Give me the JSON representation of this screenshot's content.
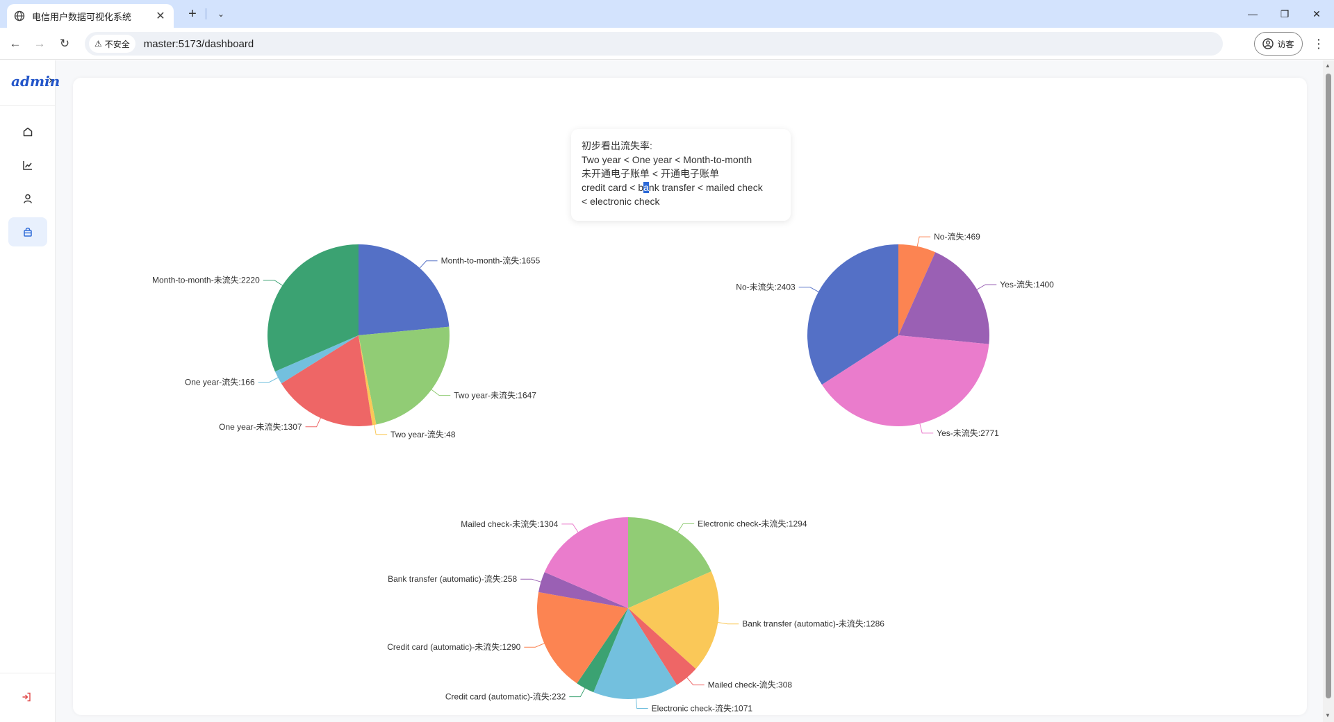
{
  "browser": {
    "tab_title": "电信用户数据可视化系统",
    "security_label": "不安全",
    "url": "master:5173/dashboard",
    "profile_label": "访客"
  },
  "sidebar": {
    "logo_text": "admin",
    "items": [
      {
        "icon": "home-icon"
      },
      {
        "icon": "line-chart-icon"
      },
      {
        "icon": "user-icon"
      },
      {
        "icon": "shopping-bag-icon",
        "active": true
      }
    ],
    "logout_icon": "logout-icon"
  },
  "note": {
    "line1": "初步看出流失率:",
    "line2": "Two year < One year < Month-to-month",
    "line3": "未开通电子账单 < 开通电子账单",
    "line4_a": "credit card < b",
    "line4_sel": "a",
    "line4_b": "nk transfer < mailed check",
    "line5": "< electronic check"
  },
  "chart_data": [
    {
      "type": "pie",
      "slices": [
        {
          "label": "Month-to-month-流失:1655",
          "value": 1655,
          "color": "#5470c6"
        },
        {
          "label": "Two year-未流失:1647",
          "value": 1647,
          "color": "#91cc75"
        },
        {
          "label": "Two year-流失:48",
          "value": 48,
          "color": "#fac858"
        },
        {
          "label": "One year-未流失:1307",
          "value": 1307,
          "color": "#ee6666"
        },
        {
          "label": "One year-流失:166",
          "value": 166,
          "color": "#73c0de"
        },
        {
          "label": "Month-to-month-未流失:2220",
          "value": 2220,
          "color": "#3ba272"
        }
      ]
    },
    {
      "type": "pie",
      "slices": [
        {
          "label": "No-流失:469",
          "value": 469,
          "color": "#fc8452"
        },
        {
          "label": "Yes-流失:1400",
          "value": 1400,
          "color": "#9a60b4"
        },
        {
          "label": "Yes-未流失:2771",
          "value": 2771,
          "color": "#ea7ccc"
        },
        {
          "label": "No-未流失:2403",
          "value": 2403,
          "color": "#5470c6"
        }
      ]
    },
    {
      "type": "pie",
      "slices": [
        {
          "label": "Electronic check-未流失:1294",
          "value": 1294,
          "color": "#91cc75"
        },
        {
          "label": "Bank transfer (automatic)-未流失:1286",
          "value": 1286,
          "color": "#fac858"
        },
        {
          "label": "Mailed check-流失:308",
          "value": 308,
          "color": "#ee6666"
        },
        {
          "label": "Electronic check-流失:1071",
          "value": 1071,
          "color": "#73c0de"
        },
        {
          "label": "Credit card (automatic)-流失:232",
          "value": 232,
          "color": "#3ba272"
        },
        {
          "label": "Credit card (automatic)-未流失:1290",
          "value": 1290,
          "color": "#fc8452"
        },
        {
          "label": "Bank transfer (automatic)-流失:258",
          "value": 258,
          "color": "#9a60b4"
        },
        {
          "label": "Mailed check-未流失:1304",
          "value": 1304,
          "color": "#ea7ccc"
        }
      ]
    }
  ]
}
